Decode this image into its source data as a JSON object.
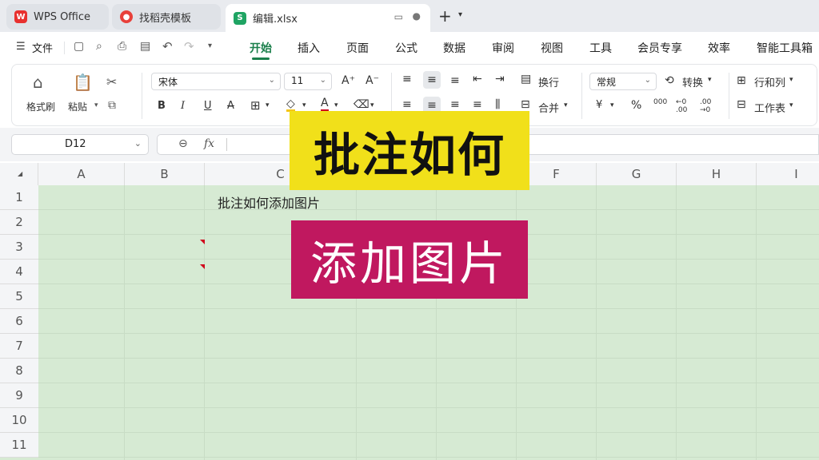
{
  "tabs": [
    {
      "label": "WPS Office",
      "icon": "wps-logo-icon",
      "icon_color": "#e8312f"
    },
    {
      "label": "找稻壳模板",
      "icon": "docer-icon",
      "icon_color": "#e8403a"
    },
    {
      "label": "编辑.xlsx",
      "icon": "spreadsheet-icon",
      "icon_color": "#1fa463"
    }
  ],
  "menu": {
    "file": "文件",
    "items": [
      "开始",
      "插入",
      "页面",
      "公式",
      "数据",
      "审阅",
      "视图",
      "工具",
      "会员专享",
      "效率",
      "智能工具箱"
    ],
    "active": "开始",
    "accent": "#1a7f4b"
  },
  "ribbon": {
    "format_painter": "格式刷",
    "paste": "粘贴",
    "font_name": "宋体",
    "font_size": "11",
    "wrap": "换行",
    "merge": "合并",
    "number_format": "常规",
    "convert": "转换",
    "rows_cols": "行和列",
    "worksheet": "工作表",
    "currency": "¥",
    "percent": "%",
    "thousands": "000",
    "dec_inc": "←0 .00",
    "dec_dec": ".00 →0"
  },
  "formula_bar": {
    "cell_ref": "D12",
    "fx": "fx",
    "value": ""
  },
  "grid": {
    "columns": [
      "A",
      "B",
      "C",
      "D",
      "E",
      "F",
      "G",
      "H",
      "I"
    ],
    "rows": [
      "1",
      "2",
      "3",
      "4",
      "5",
      "6",
      "7",
      "8",
      "9",
      "10",
      "11"
    ],
    "c1_text": "批注如何添加图片",
    "background": "#d6ead3"
  },
  "overlay": {
    "line1": "批注如何",
    "line1_bg": "#f1e01a",
    "line2": "添加图片",
    "line2_bg": "#c0185f"
  }
}
